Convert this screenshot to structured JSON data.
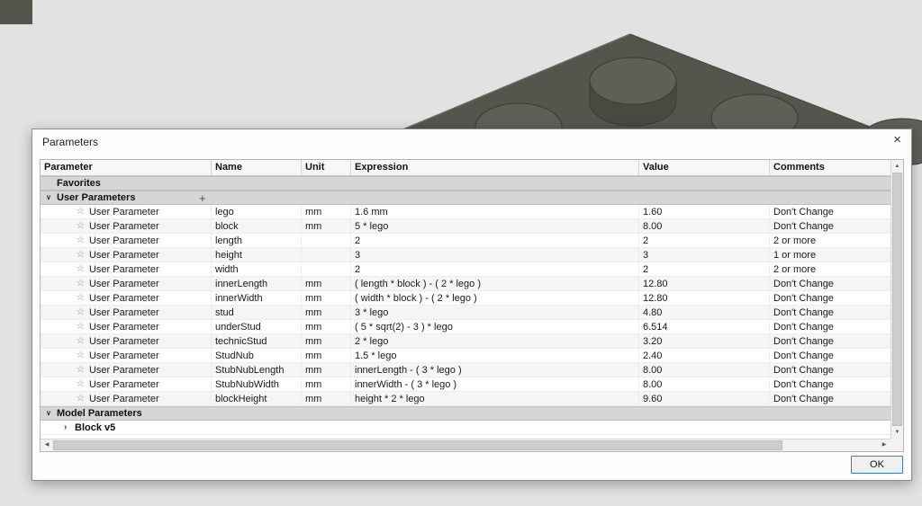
{
  "scene": {
    "plate_color": "#55554e",
    "stud_top_color": "#5f5f58",
    "stud_side_color": "#494942",
    "outline_color": "#3b3b35"
  },
  "dialog": {
    "title": "Parameters",
    "close_glyph": "×",
    "ok_label": "OK"
  },
  "icons": {
    "star": "☆",
    "chevron_expanded": "∨",
    "chevron_collapsed": "›",
    "plus": "+",
    "scroll_up": "▲",
    "scroll_down": "▼",
    "scroll_left": "◀",
    "scroll_right": "▶"
  },
  "table": {
    "columns": [
      "Parameter",
      "Name",
      "Unit",
      "Expression",
      "Value",
      "Comments"
    ],
    "rows": [
      {
        "type": "group",
        "label": "Favorites",
        "chevron": false,
        "plus": false
      },
      {
        "type": "group",
        "label": "User Parameters",
        "chevron": true,
        "plus": true
      },
      {
        "type": "param",
        "parameter": "User Parameter",
        "name": "lego",
        "unit": "mm",
        "expression": "1.6 mm",
        "value": "1.60",
        "comment": "Don't Change"
      },
      {
        "type": "param",
        "parameter": "User Parameter",
        "name": "block",
        "unit": "mm",
        "expression": "5 * lego",
        "value": "8.00",
        "comment": "Don't Change"
      },
      {
        "type": "param",
        "parameter": "User Parameter",
        "name": "length",
        "unit": "",
        "expression": "2",
        "value": "2",
        "comment": "2 or more"
      },
      {
        "type": "param",
        "parameter": "User Parameter",
        "name": "height",
        "unit": "",
        "expression": "3",
        "value": "3",
        "comment": "1 or more"
      },
      {
        "type": "param",
        "parameter": "User Parameter",
        "name": "width",
        "unit": "",
        "expression": "2",
        "value": "2",
        "comment": "2 or more"
      },
      {
        "type": "param",
        "parameter": "User Parameter",
        "name": "innerLength",
        "unit": "mm",
        "expression": "( length * block ) - ( 2 * lego )",
        "value": "12.80",
        "comment": "Don't Change"
      },
      {
        "type": "param",
        "parameter": "User Parameter",
        "name": "innerWidth",
        "unit": "mm",
        "expression": "( width * block ) - ( 2 * lego )",
        "value": "12.80",
        "comment": "Don't Change"
      },
      {
        "type": "param",
        "parameter": "User Parameter",
        "name": "stud",
        "unit": "mm",
        "expression": "3 * lego",
        "value": "4.80",
        "comment": "Don't Change"
      },
      {
        "type": "param",
        "parameter": "User Parameter",
        "name": "underStud",
        "unit": "mm",
        "expression": "( 5 * sqrt(2) - 3 ) * lego",
        "value": "6.514",
        "comment": "Don't Change"
      },
      {
        "type": "param",
        "parameter": "User Parameter",
        "name": "technicStud",
        "unit": "mm",
        "expression": "2 * lego",
        "value": "3.20",
        "comment": "Don't Change"
      },
      {
        "type": "param",
        "parameter": "User Parameter",
        "name": "StudNub",
        "unit": "mm",
        "expression": "1.5 * lego",
        "value": "2.40",
        "comment": "Don't Change"
      },
      {
        "type": "param",
        "parameter": "User Parameter",
        "name": "StubNubLength",
        "unit": "mm",
        "expression": "innerLength - ( 3 * lego )",
        "value": "8.00",
        "comment": "Don't Change"
      },
      {
        "type": "param",
        "parameter": "User Parameter",
        "name": "StubNubWidth",
        "unit": "mm",
        "expression": "innerWidth - ( 3 * lego )",
        "value": "8.00",
        "comment": "Don't Change"
      },
      {
        "type": "param",
        "parameter": "User Parameter",
        "name": "blockHeight",
        "unit": "mm",
        "expression": "height * 2 * lego",
        "value": "9.60",
        "comment": "Don't Change"
      },
      {
        "type": "group",
        "label": "Model Parameters",
        "chevron": true,
        "plus": false
      },
      {
        "type": "child",
        "label": "Block v5"
      }
    ]
  }
}
